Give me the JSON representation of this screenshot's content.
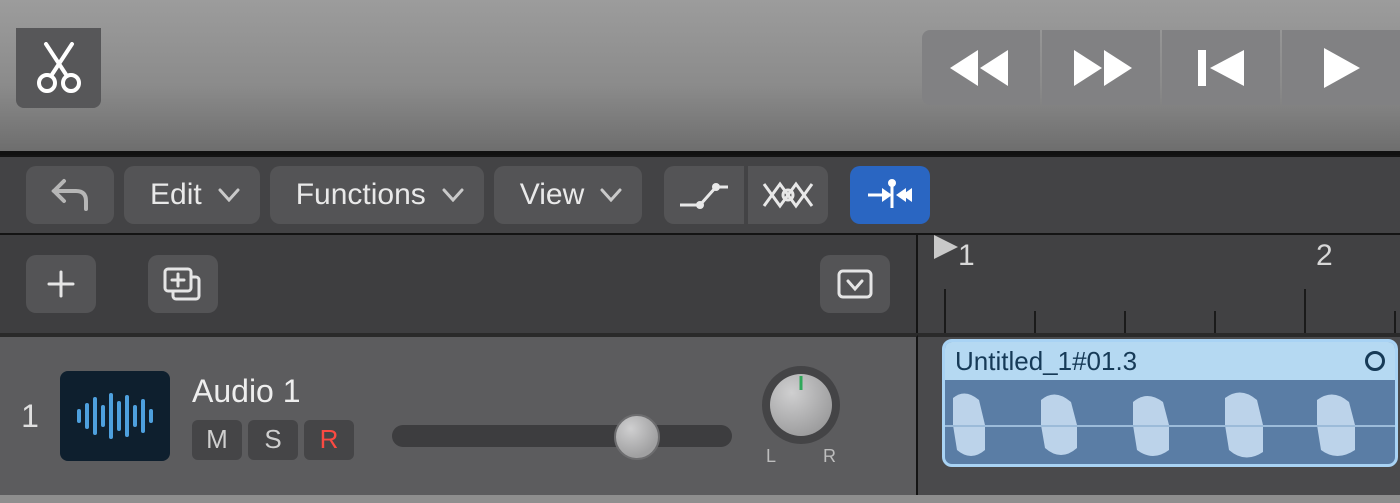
{
  "toolbar": {
    "scissors_icon": "scissors"
  },
  "transport": {
    "rewind": "rewind",
    "fast_forward": "fast_forward",
    "go_to_start": "go_to_start",
    "play": "play"
  },
  "editor_menu": {
    "edit_label": "Edit",
    "functions_label": "Functions",
    "view_label": "View"
  },
  "editor_toggles": {
    "automation": "automation-curve",
    "flex": "flex",
    "catch_playhead": "catch-playhead",
    "catch_active": true
  },
  "track_controls": {
    "add": "+",
    "duplicate": "duplicate"
  },
  "ruler": {
    "marker_1": "1",
    "marker_2": "2"
  },
  "track": {
    "number": "1",
    "name": "Audio 1",
    "mute_label": "M",
    "solo_label": "S",
    "record_label": "R",
    "pan_left": "L",
    "pan_right": "R"
  },
  "region": {
    "name": "Untitled_1#01.3"
  }
}
